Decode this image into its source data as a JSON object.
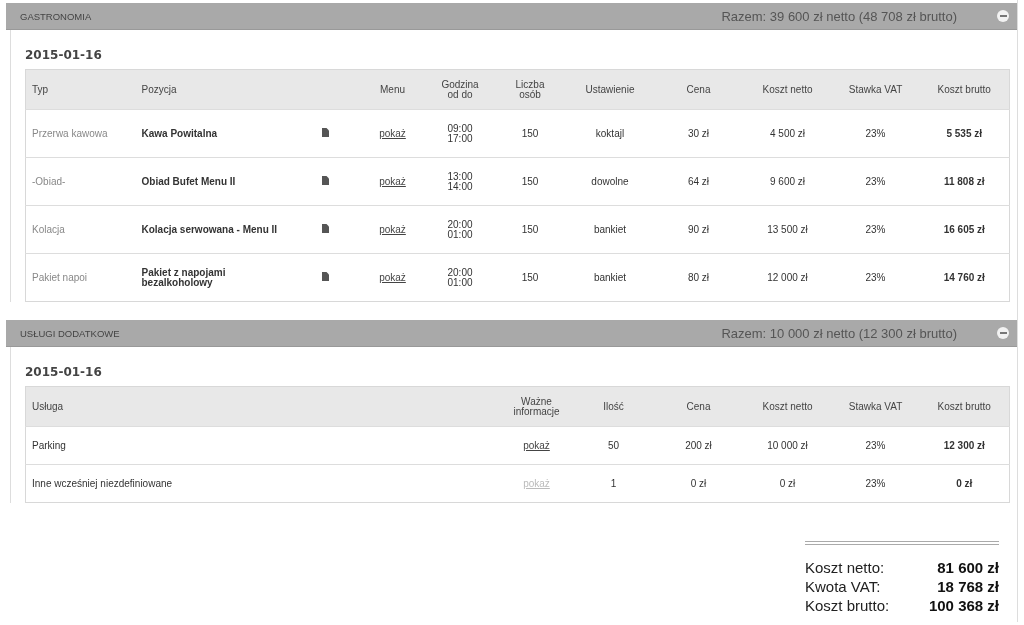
{
  "sections": [
    {
      "kind": "catering",
      "title": "GASTRONOMIA",
      "total": "Razem: 39 600 zł netto (48 708 zł brutto)",
      "expanded": true,
      "date": "2015-01-16",
      "columns": [
        "Typ",
        "Pozycja",
        "",
        "Menu",
        "Godzina od do",
        "Liczba osób",
        "Ustawienie",
        "Cena",
        "Koszt netto",
        "Stawka VAT",
        "Koszt brutto"
      ],
      "rows": [
        {
          "type": "Przerwa kawowa",
          "item": "Kawa Powitalna",
          "menu": "pokaż",
          "time_from": "09:00",
          "time_to": "17:00",
          "persons": "150",
          "setup": "koktajl",
          "price": "30 zł",
          "net": "4 500 zł",
          "vat": "23%",
          "gross": "5 535 zł"
        },
        {
          "type": "-Obiad-",
          "item": "Obiad Bufet Menu II",
          "menu": "pokaż",
          "time_from": "13:00",
          "time_to": "14:00",
          "persons": "150",
          "setup": "dowolne",
          "price": "64 zł",
          "net": "9 600 zł",
          "vat": "23%",
          "gross": "11 808 zł"
        },
        {
          "type": "Kolacja",
          "item": "Kolacja serwowana - Menu II",
          "menu": "pokaż",
          "time_from": "20:00",
          "time_to": "01:00",
          "persons": "150",
          "setup": "bankiet",
          "price": "90 zł",
          "net": "13 500 zł",
          "vat": "23%",
          "gross": "16 605 zł"
        },
        {
          "type": "Pakiet napoi",
          "item": "Pakiet z napojami bezalkoholowy",
          "menu": "pokaż",
          "time_from": "20:00",
          "time_to": "01:00",
          "persons": "150",
          "setup": "bankiet",
          "price": "80 zł",
          "net": "12 000 zł",
          "vat": "23%",
          "gross": "14 760 zł"
        }
      ]
    },
    {
      "kind": "services",
      "title": "USŁUGI DODATKOWE",
      "total": "Razem: 10 000 zł netto (12 300 zł brutto)",
      "expanded": true,
      "date": "2015-01-16",
      "columns": [
        "Usługa",
        "Ważne informacje",
        "Ilość",
        "Cena",
        "Koszt netto",
        "Stawka VAT",
        "Koszt brutto"
      ],
      "rows": [
        {
          "service": "Parking",
          "info": "pokaż",
          "info_disabled": false,
          "qty": "50",
          "price": "200 zł",
          "net": "10 000 zł",
          "vat": "23%",
          "gross": "12 300 zł"
        },
        {
          "service": "Inne wcześniej niezdefiniowane",
          "info": "pokaż",
          "info_disabled": true,
          "qty": "1",
          "price": "0 zł",
          "net": "0 zł",
          "vat": "23%",
          "gross": "0 zł"
        }
      ]
    }
  ],
  "summary": [
    {
      "label": "Koszt netto:",
      "value": "81 600 zł"
    },
    {
      "label": "Kwota VAT:",
      "value": "18 768 zł"
    },
    {
      "label": "Koszt brutto:",
      "value": "100 368 zł"
    }
  ]
}
